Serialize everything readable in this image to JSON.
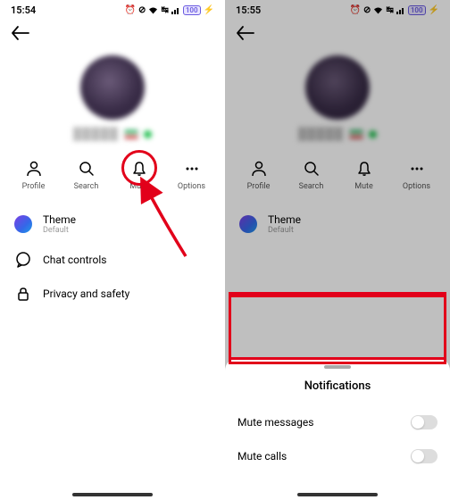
{
  "status": {
    "time": "15:54",
    "time2": "15:55",
    "battery": "100"
  },
  "actions": {
    "profile": "Profile",
    "search": "Search",
    "mute": "Mute",
    "options": "Options"
  },
  "settings": {
    "theme": {
      "title": "Theme",
      "sub": "Default"
    },
    "chat": "Chat controls",
    "privacy": "Privacy and safety"
  },
  "sheet": {
    "title": "Notifications",
    "muteMessages": "Mute messages",
    "muteCalls": "Mute calls"
  }
}
